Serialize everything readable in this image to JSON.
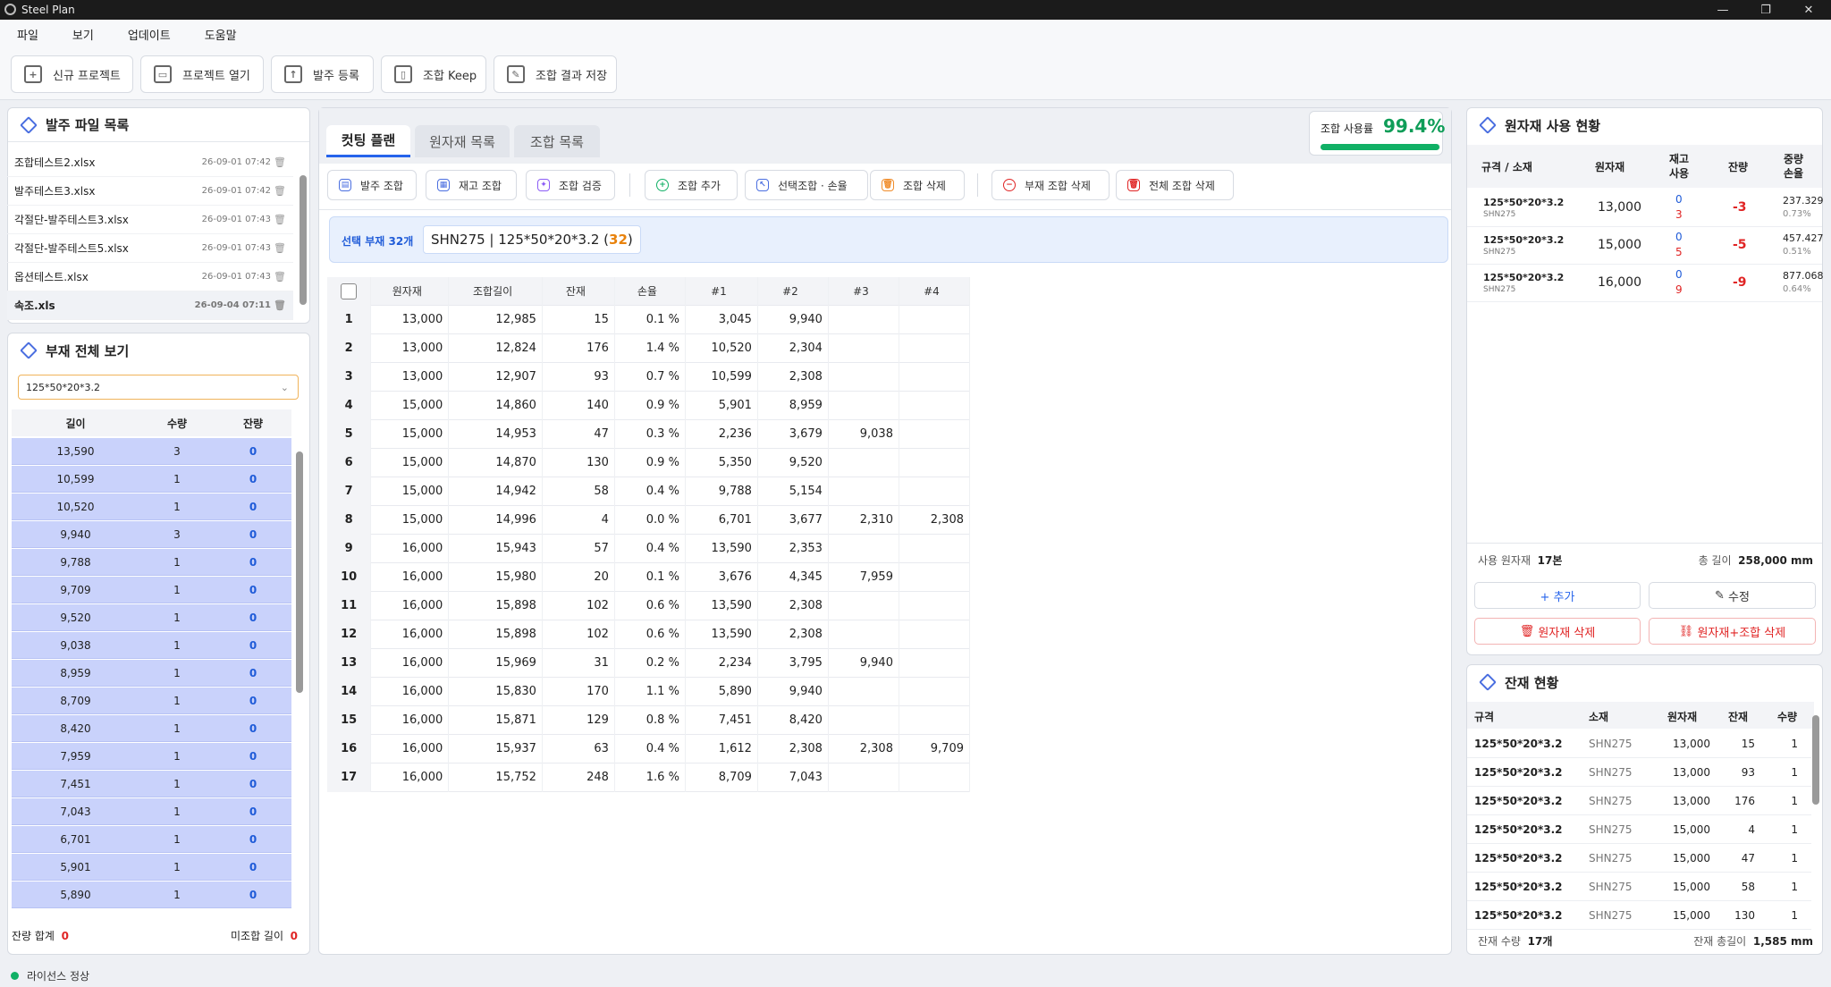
{
  "window": {
    "title": "Steel Plan",
    "minimize": "—",
    "restore": "❐",
    "close": "✕"
  },
  "menu": [
    "파일",
    "보기",
    "업데이트",
    "도움말"
  ],
  "toolbar": [
    {
      "label": "신규 프로젝트",
      "icon": "file-plus-icon"
    },
    {
      "label": "프로젝트 열기",
      "icon": "folder-icon"
    },
    {
      "label": "발주 등록",
      "icon": "upload-icon"
    },
    {
      "label": "조합 Keep",
      "icon": "bookmark-icon"
    },
    {
      "label": "조합 결과 저장",
      "icon": "edit-icon"
    }
  ],
  "orderFiles": {
    "title": "발주 파일 목록",
    "files": [
      {
        "name": "조합테스트2.xlsx",
        "date": "26-09-01 07:42"
      },
      {
        "name": "발주테스트3.xlsx",
        "date": "26-09-01 07:42"
      },
      {
        "name": "각절단-발주테스트3.xlsx",
        "date": "26-09-01 07:43"
      },
      {
        "name": "각절단-발주테스트5.xlsx",
        "date": "26-09-01 07:43"
      },
      {
        "name": "옵션테스트.xlsx",
        "date": "26-09-01 07:43"
      },
      {
        "name": "속조.xls",
        "date": "26-09-04 07:11"
      }
    ]
  },
  "parts": {
    "title": "부재 전체 보기",
    "select": "125*50*20*3.2",
    "headers": [
      "길이",
      "수량",
      "잔량"
    ],
    "rows": [
      [
        "13,590",
        "3",
        "0"
      ],
      [
        "10,599",
        "1",
        "0"
      ],
      [
        "10,520",
        "1",
        "0"
      ],
      [
        "9,940",
        "3",
        "0"
      ],
      [
        "9,788",
        "1",
        "0"
      ],
      [
        "9,709",
        "1",
        "0"
      ],
      [
        "9,520",
        "1",
        "0"
      ],
      [
        "9,038",
        "1",
        "0"
      ],
      [
        "8,959",
        "1",
        "0"
      ],
      [
        "8,709",
        "1",
        "0"
      ],
      [
        "8,420",
        "1",
        "0"
      ],
      [
        "7,959",
        "1",
        "0"
      ],
      [
        "7,451",
        "1",
        "0"
      ],
      [
        "7,043",
        "1",
        "0"
      ],
      [
        "6,701",
        "1",
        "0"
      ],
      [
        "5,901",
        "1",
        "0"
      ],
      [
        "5,890",
        "1",
        "0"
      ]
    ],
    "footer_left_label": "잔량 합계",
    "footer_left_value": "0",
    "footer_right_label": "미조합 길이",
    "footer_right_value": "0"
  },
  "tabs": [
    "컷팅 플랜",
    "원자재 목록",
    "조합 목록"
  ],
  "usage": {
    "label": "조합 사용률",
    "value": "99.4%",
    "percent": 99.4
  },
  "actions": [
    "발주 조합",
    "재고 조합",
    "조합 검증",
    "조합 추가",
    "선택조합 · 손율",
    "조합 삭제",
    "부재 조합 삭제",
    "전체 조합 삭제"
  ],
  "selected": {
    "label": "선택 부재",
    "count": "32개",
    "spec": "SHN275 | 125*50*20*3.2 (",
    "num": "32",
    ")": ")"
  },
  "plan": {
    "headers": [
      "원자재",
      "조합길이",
      "잔재",
      "손율",
      "#1",
      "#2",
      "#3",
      "#4"
    ],
    "rows": [
      [
        "1",
        "13,000",
        "12,985",
        "15",
        "0.1 %",
        "3,045",
        "9,940",
        "",
        ""
      ],
      [
        "2",
        "13,000",
        "12,824",
        "176",
        "1.4 %",
        "10,520",
        "2,304",
        "",
        ""
      ],
      [
        "3",
        "13,000",
        "12,907",
        "93",
        "0.7 %",
        "10,599",
        "2,308",
        "",
        ""
      ],
      [
        "4",
        "15,000",
        "14,860",
        "140",
        "0.9 %",
        "5,901",
        "8,959",
        "",
        ""
      ],
      [
        "5",
        "15,000",
        "14,953",
        "47",
        "0.3 %",
        "2,236",
        "3,679",
        "9,038",
        ""
      ],
      [
        "6",
        "15,000",
        "14,870",
        "130",
        "0.9 %",
        "5,350",
        "9,520",
        "",
        ""
      ],
      [
        "7",
        "15,000",
        "14,942",
        "58",
        "0.4 %",
        "9,788",
        "5,154",
        "",
        ""
      ],
      [
        "8",
        "15,000",
        "14,996",
        "4",
        "0.0 %",
        "6,701",
        "3,677",
        "2,310",
        "2,308"
      ],
      [
        "9",
        "16,000",
        "15,943",
        "57",
        "0.4 %",
        "13,590",
        "2,353",
        "",
        ""
      ],
      [
        "10",
        "16,000",
        "15,980",
        "20",
        "0.1 %",
        "3,676",
        "4,345",
        "7,959",
        ""
      ],
      [
        "11",
        "16,000",
        "15,898",
        "102",
        "0.6 %",
        "13,590",
        "2,308",
        "",
        ""
      ],
      [
        "12",
        "16,000",
        "15,898",
        "102",
        "0.6 %",
        "13,590",
        "2,308",
        "",
        ""
      ],
      [
        "13",
        "16,000",
        "15,969",
        "31",
        "0.2 %",
        "2,234",
        "3,795",
        "9,940",
        ""
      ],
      [
        "14",
        "16,000",
        "15,830",
        "170",
        "1.1 %",
        "5,890",
        "9,940",
        "",
        ""
      ],
      [
        "15",
        "16,000",
        "15,871",
        "129",
        "0.8 %",
        "7,451",
        "8,420",
        "",
        ""
      ],
      [
        "16",
        "16,000",
        "15,937",
        "63",
        "0.4 %",
        "1,612",
        "2,308",
        "2,308",
        "9,709"
      ],
      [
        "17",
        "16,000",
        "15,752",
        "248",
        "1.6 %",
        "8,709",
        "7,043",
        "",
        ""
      ]
    ]
  },
  "material": {
    "title": "원자재 사용 현황",
    "headers": [
      "규격 / 소재",
      "원자재",
      "재고 사용",
      "잔량",
      "중량 손율"
    ],
    "rows": [
      {
        "spec": "125*50*20*3.2",
        "mat": "SHN275",
        "len": "13,000",
        "stock": "0",
        "use": "3",
        "rem": "-3",
        "w": "237.329",
        "r": "0.73%"
      },
      {
        "spec": "125*50*20*3.2",
        "mat": "SHN275",
        "len": "15,000",
        "stock": "0",
        "use": "5",
        "rem": "-5",
        "w": "457.427",
        "r": "0.51%"
      },
      {
        "spec": "125*50*20*3.2",
        "mat": "SHN275",
        "len": "16,000",
        "stock": "0",
        "use": "9",
        "rem": "-9",
        "w": "877.068",
        "r": "0.64%"
      }
    ],
    "used_label": "사용 원자재",
    "used_value": "17본",
    "total_label": "총 길이",
    "total_value": "258,000 mm",
    "btn_add": "+ 추가",
    "btn_edit": "수정",
    "btn_del": "원자재 삭제",
    "btn_del2": "원자재+조합 삭제"
  },
  "remnant": {
    "title": "잔재 현황",
    "headers": [
      "규격",
      "소재",
      "원자재",
      "잔재",
      "수량"
    ],
    "rows": [
      [
        "125*50*20*3.2",
        "SHN275",
        "13,000",
        "15",
        "1"
      ],
      [
        "125*50*20*3.2",
        "SHN275",
        "13,000",
        "93",
        "1"
      ],
      [
        "125*50*20*3.2",
        "SHN275",
        "13,000",
        "176",
        "1"
      ],
      [
        "125*50*20*3.2",
        "SHN275",
        "15,000",
        "4",
        "1"
      ],
      [
        "125*50*20*3.2",
        "SHN275",
        "15,000",
        "47",
        "1"
      ],
      [
        "125*50*20*3.2",
        "SHN275",
        "15,000",
        "58",
        "1"
      ],
      [
        "125*50*20*3.2",
        "SHN275",
        "15,000",
        "130",
        "1"
      ]
    ],
    "qty_label": "잔재 수량",
    "qty_value": "17개",
    "len_label": "잔재 총길이",
    "len_value": "1,585 mm"
  },
  "status": "라이선스 정상"
}
